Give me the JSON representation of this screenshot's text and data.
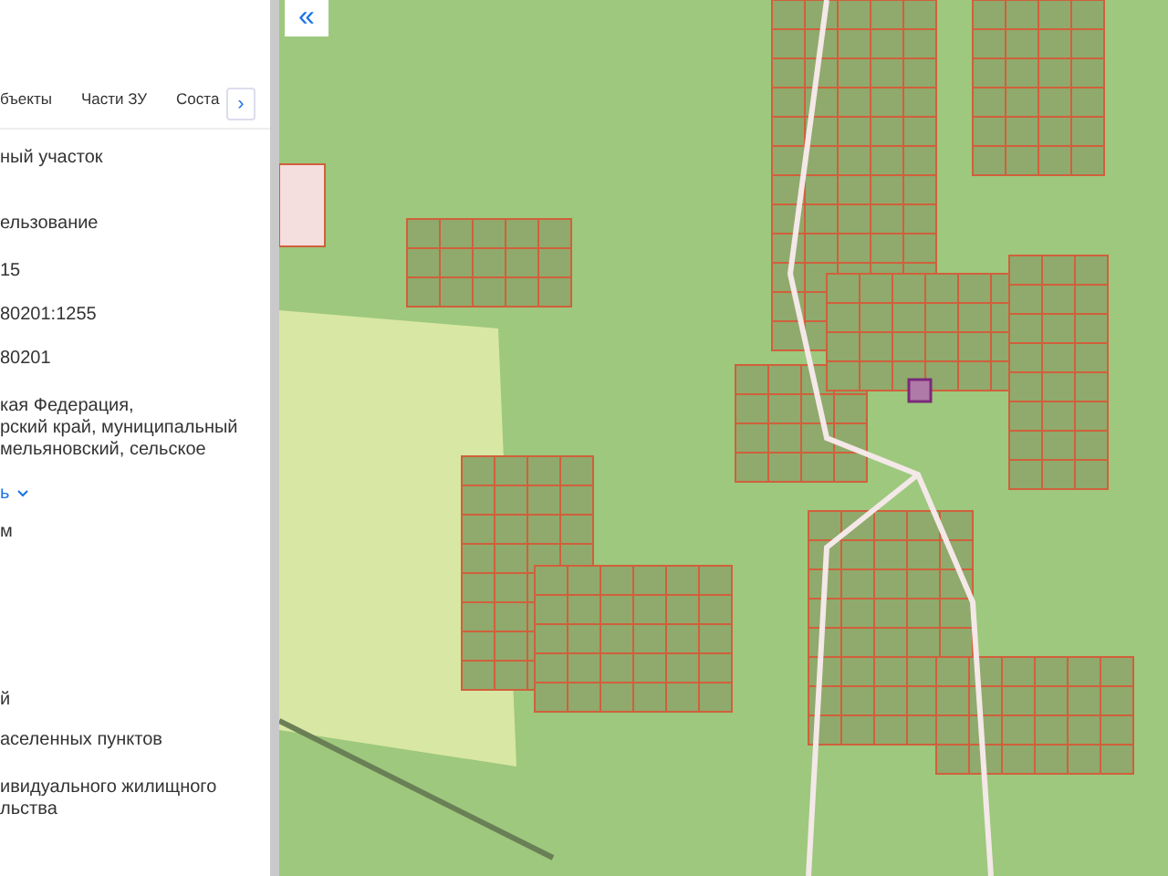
{
  "sidebar": {
    "tabs": [
      {
        "label": "бъекты",
        "selected": false
      },
      {
        "label": "Части ЗУ",
        "selected": false
      },
      {
        "label": "Соста",
        "selected": false
      }
    ],
    "tabs_scroll_button": "›",
    "fields": [
      {
        "kind": "text",
        "lines": [
          "ный участок"
        ]
      },
      {
        "kind": "text",
        "lines": [
          "ельзование"
        ]
      },
      {
        "kind": "text",
        "lines": [
          "15"
        ]
      },
      {
        "kind": "text",
        "lines": [
          "80201:1255"
        ]
      },
      {
        "kind": "text",
        "lines": [
          "80201"
        ]
      },
      {
        "kind": "text",
        "lines": [
          "кая Федерация,",
          "рский край, муниципальный",
          "мельяновский, сельское"
        ]
      },
      {
        "kind": "link",
        "lines": [
          "ь"
        ]
      },
      {
        "kind": "text",
        "lines": [
          "м"
        ]
      },
      {
        "kind": "spacer"
      },
      {
        "kind": "text",
        "lines": [
          "й"
        ]
      },
      {
        "kind": "text",
        "lines": [
          "аселенных пунктов"
        ]
      },
      {
        "kind": "text",
        "lines": [
          "ивидуального жилищного",
          "льства"
        ]
      }
    ]
  },
  "map": {
    "collapse_button": "«"
  }
}
